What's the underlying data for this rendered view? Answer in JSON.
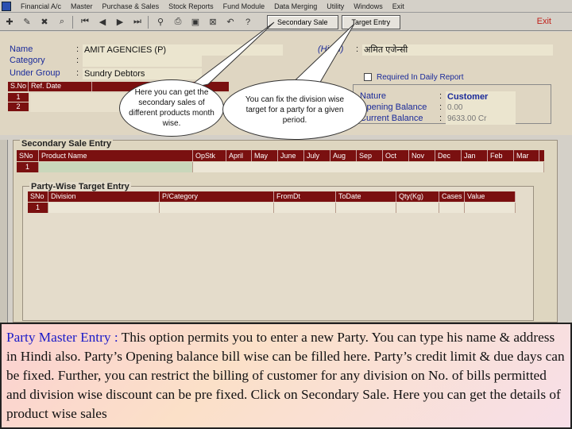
{
  "menu": {
    "items": [
      "Financial A/c",
      "Master",
      "Purchase & Sales",
      "Stock Reports",
      "Fund Module",
      "Data Merging",
      "Utility",
      "Windows",
      "Exit"
    ]
  },
  "toolbar": {
    "tabs": [
      "Secondary Sale",
      "Target Entry"
    ],
    "exit_label": "Exit"
  },
  "party": {
    "name_label": "Name",
    "name_value": "AMIT AGENCIES (P)",
    "category_label": "Category",
    "category_value": "",
    "under_group_label": "Under Group",
    "under_group_value": "Sundry Debtors",
    "hindi_label": "(Hindi)",
    "hindi_value": "अमित एजेन्सी",
    "required_daily_report": "Required In Daily Report"
  },
  "bill_table": {
    "headers": [
      "S.No",
      "Ref. Date"
    ],
    "rows": [
      "1",
      "2"
    ]
  },
  "balance": {
    "nature_label": "Nature",
    "nature_value": "Customer",
    "opening_label": "Opening Balance",
    "opening_value": "0.00",
    "current_label": "Current Balance",
    "current_value": "9633.00 Cr"
  },
  "secondary_sale": {
    "title": "Secondary Sale Entry",
    "columns": [
      "SNo",
      "Product Name",
      "OpStk",
      "April",
      "May",
      "June",
      "July",
      "Aug",
      "Sep",
      "Oct",
      "Nov",
      "Dec",
      "Jan",
      "Feb",
      "Mar"
    ],
    "first_row": "1"
  },
  "target_entry": {
    "title": "Party-Wise Target Entry",
    "columns": [
      "SNo",
      "Division",
      "P/Category",
      "FromDt",
      "ToDate",
      "Qty(Kg)",
      "Cases",
      "Value"
    ],
    "first_row": "1"
  },
  "callouts": {
    "secondary": "Here you can get the secondary sales of different products month wise.",
    "target": "You can fix the division wise target for a party for a given period."
  },
  "explanation": {
    "heading": "Party Master Entry : ",
    "body": "This option permits you to enter a new Party. You can type his name & address in Hindi also. Party’s Opening balance bill wise can be filled here. Party’s  credit limit & due days can be fixed. Further, you can restrict the billing of customer for any division on No. of bills permitted and division wise discount can be pre fixed. Click on Secondary Sale. Here you can get the details of product wise sales"
  }
}
